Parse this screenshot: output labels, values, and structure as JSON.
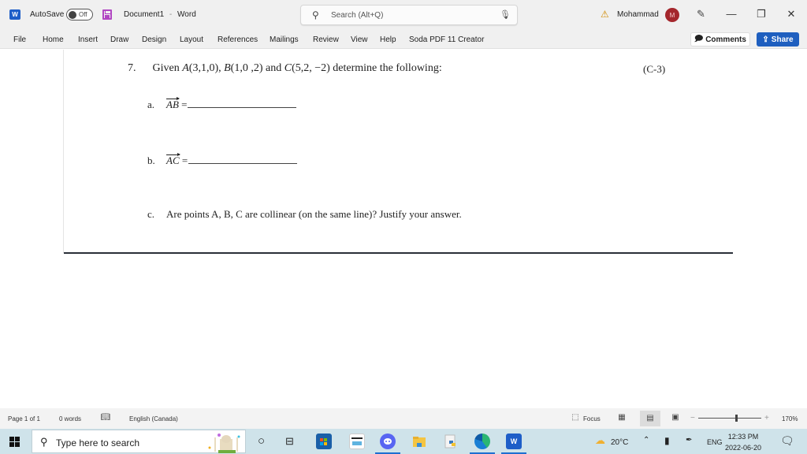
{
  "titlebar": {
    "app_icon": "word-icon",
    "autosave_label": "AutoSave",
    "autosave_state": "Off",
    "save_icon": "save-icon",
    "document_name": "Document1",
    "separator": "-",
    "app_name": "Word",
    "search_placeholder": "Search (Alt+Q)",
    "warning_icon": "warning-icon",
    "user_name": "Mohammad",
    "avatar_initial": "M",
    "colors": {
      "avatar": "#a4262c",
      "save_icon": "#b146c2"
    }
  },
  "ribbon": {
    "tabs": [
      "File",
      "Home",
      "Insert",
      "Draw",
      "Design",
      "Layout",
      "References",
      "Mailings",
      "Review",
      "View",
      "Help",
      "Soda PDF 11 Creator"
    ],
    "comments_label": "Comments",
    "share_label": "Share",
    "share_color": "#1f5fbf"
  },
  "document": {
    "question_number": "7.",
    "question_prefix": "Given",
    "point_a": "A",
    "point_a_coords": "(3,1,0),",
    "point_b": "B",
    "point_b_coords": "(1,0 ,2)",
    "and_text": "and",
    "point_c": "C",
    "point_c_coords": "(5,2, −2)",
    "question_suffix": "determine the following:",
    "code": "(C-3)",
    "part_a_label": "a.",
    "part_a_vector": "AB",
    "part_b_label": "b.",
    "part_b_vector": "AC",
    "equals": "=",
    "part_c_label": "c.",
    "part_c_text": "Are points A, B, C are collinear (on the same line)? Justify your answer."
  },
  "statusbar": {
    "page": "Page 1 of 1",
    "words": "0 words",
    "language": "English (Canada)",
    "focus_label": "Focus",
    "zoom_minus": "−",
    "zoom_plus": "+",
    "zoom_level": "170%"
  },
  "taskbar": {
    "search_placeholder": "Type here to search",
    "weather_temp": "20°C",
    "language": "ENG",
    "time": "12:33 PM",
    "date": "2022-06-20"
  }
}
